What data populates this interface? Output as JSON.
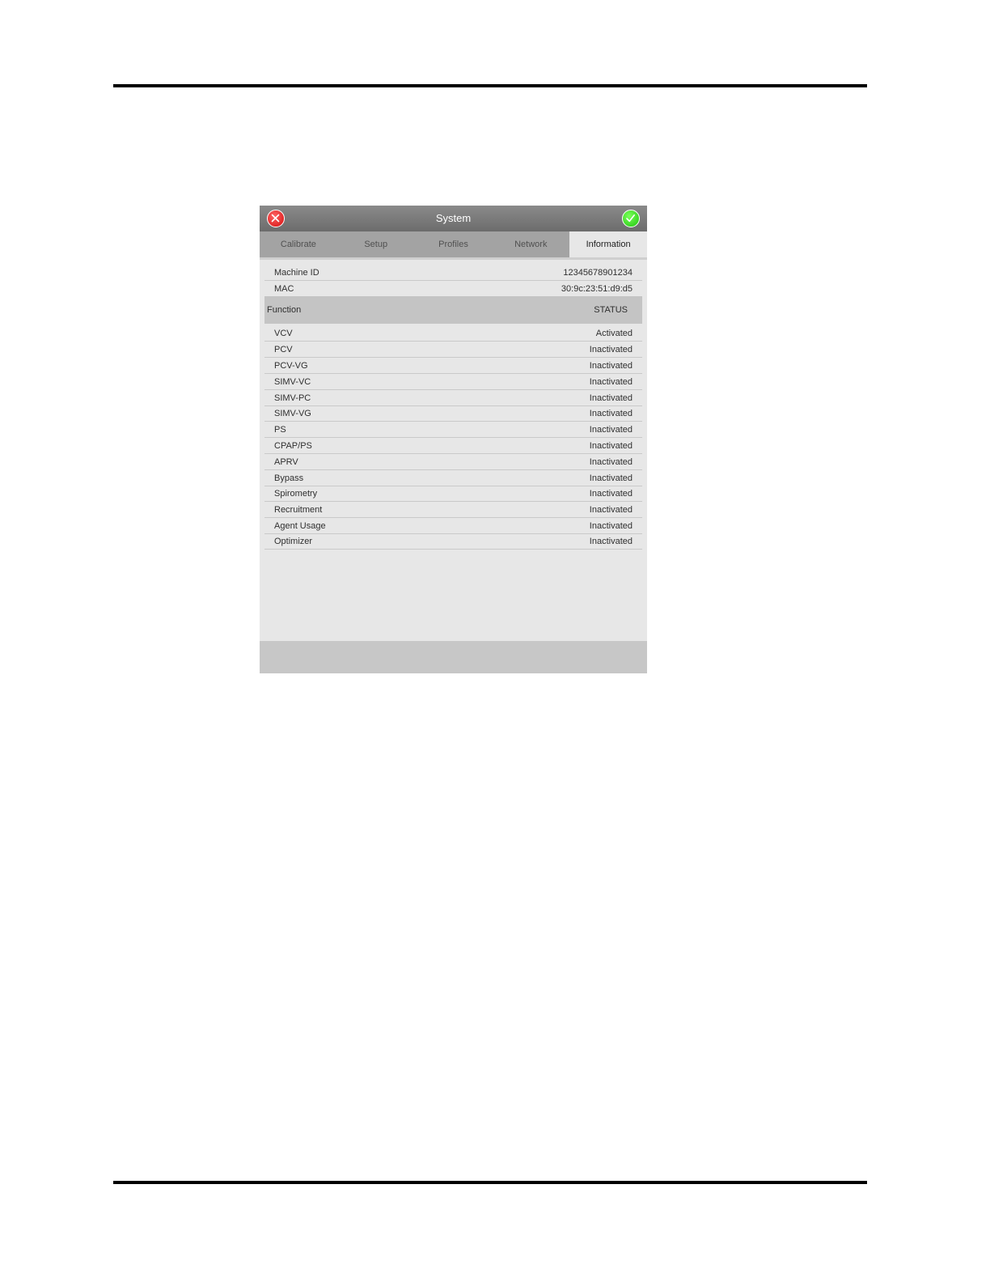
{
  "window": {
    "title": "System",
    "close_icon": "close-x-icon",
    "confirm_icon": "checkmark-icon",
    "close_color": "#e01818",
    "confirm_color": "#2ad41a"
  },
  "tabs": [
    {
      "label": "Calibrate"
    },
    {
      "label": "Setup"
    },
    {
      "label": "Profiles"
    },
    {
      "label": "Network"
    },
    {
      "label": "Information",
      "active": true
    }
  ],
  "info": [
    {
      "label": "Machine ID",
      "value": "12345678901234"
    },
    {
      "label": "MAC",
      "value": "30:9c:23:51:d9:d5"
    }
  ],
  "function_header": {
    "label": "Function",
    "value": "STATUS"
  },
  "functions": [
    {
      "label": "VCV",
      "value": "Activated"
    },
    {
      "label": "PCV",
      "value": "Inactivated"
    },
    {
      "label": "PCV-VG",
      "value": "Inactivated"
    },
    {
      "label": "SIMV-VC",
      "value": "Inactivated"
    },
    {
      "label": "SIMV-PC",
      "value": "Inactivated"
    },
    {
      "label": "SIMV-VG",
      "value": "Inactivated"
    },
    {
      "label": "PS",
      "value": "Inactivated"
    },
    {
      "label": "CPAP/PS",
      "value": "Inactivated"
    },
    {
      "label": "APRV",
      "value": "Inactivated"
    },
    {
      "label": "Bypass",
      "value": "Inactivated"
    },
    {
      "label": "Spirometry",
      "value": "Inactivated"
    },
    {
      "label": "Recruitment",
      "value": "Inactivated"
    },
    {
      "label": "Agent Usage",
      "value": "Inactivated"
    },
    {
      "label": "Optimizer",
      "value": "Inactivated"
    }
  ]
}
